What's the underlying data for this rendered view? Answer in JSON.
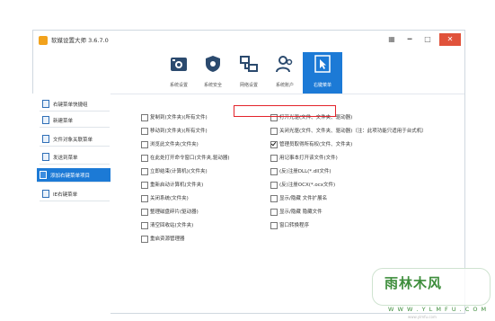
{
  "window": {
    "title": "软媒设置大师 3.6.7.0",
    "controls": [
      "▦",
      "━",
      "□",
      "✕"
    ]
  },
  "toolbar": {
    "buttons": [
      {
        "label": "系统设置",
        "icon": "camera-icon"
      },
      {
        "label": "系统安全",
        "icon": "shield-icon"
      },
      {
        "label": "网络设置",
        "icon": "network-icon"
      },
      {
        "label": "系统账户",
        "icon": "users-icon"
      },
      {
        "label": "右键菜单",
        "icon": "cursor-icon",
        "active": true
      }
    ]
  },
  "sidebar": {
    "items": [
      {
        "label": "右键菜单快捷组"
      },
      {
        "label": "新建菜单"
      },
      {
        "label": "文件对象关联菜单"
      },
      {
        "label": "发送到菜单"
      },
      {
        "label": "添加右键菜单项目",
        "active": true
      },
      {
        "label": "IE右键菜单"
      }
    ]
  },
  "options": {
    "left": [
      {
        "label": "复制到(文件夹)(所有文件)",
        "checked": false
      },
      {
        "label": "移动到(文件夹)(所有文件)",
        "checked": false
      },
      {
        "label": "浏览此文件夹(文件夹)",
        "checked": false
      },
      {
        "label": "在此处打开命令窗口(文件夹,驱动器)",
        "checked": false
      },
      {
        "label": "立即结束(计算机)(文件夹)",
        "checked": false
      },
      {
        "label": "重新启动计算机(文件夹)",
        "checked": false
      },
      {
        "label": "关闭系统(文件夹)",
        "checked": false
      },
      {
        "label": "整理磁盘碎片(驱动器)",
        "checked": false
      },
      {
        "label": "清空回收站(文件夹)",
        "checked": false
      },
      {
        "label": "重启资源管理器",
        "checked": false
      }
    ],
    "right": [
      {
        "label": "打开光驱(文件、文件夹、驱动器)",
        "checked": false
      },
      {
        "label": "关闭光驱(文件、文件夹、驱动器)（注：此项功能只适用于台式机）",
        "checked": false
      },
      {
        "label": "管理员取得所有权(文件、文件夹)",
        "checked": true
      },
      {
        "label": "用记事本打开该文件(文件)",
        "checked": false
      },
      {
        "label": "(反)注册DLL(*.dll文件)",
        "checked": false
      },
      {
        "label": "(反)注册OCX(*.ocx文件)",
        "checked": false
      },
      {
        "label": "显示/隐藏 文件扩展名",
        "checked": false
      },
      {
        "label": "显示/隐藏 隐藏文件",
        "checked": false
      },
      {
        "label": "窗口转换程序",
        "checked": false
      }
    ]
  },
  "watermark": {
    "brand": "雨林木风",
    "url": "W W W . Y L M F U . C O M",
    "url2": "www.ylmfu.com"
  },
  "colors": {
    "accent": "#1c7ad6",
    "highlight": "#e3232b",
    "close": "#e0523b"
  }
}
